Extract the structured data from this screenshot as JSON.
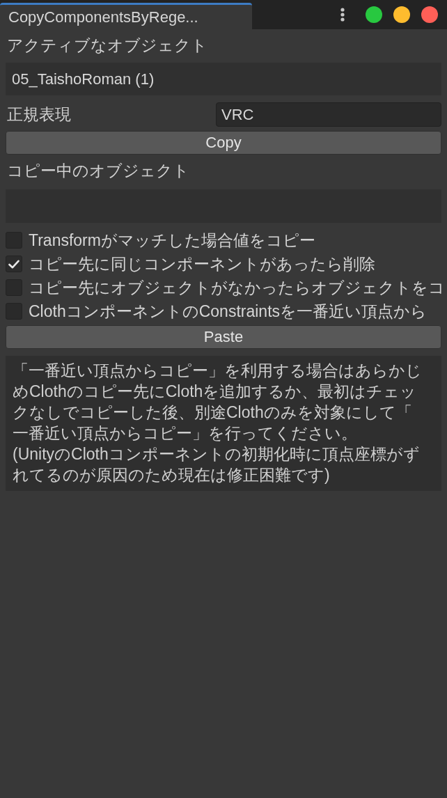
{
  "window": {
    "tab_title": "CopyComponentsByRege..."
  },
  "active_object": {
    "label": "アクティブなオブジェクト",
    "value": "05_TaishoRoman (1)"
  },
  "regex": {
    "label": "正規表現",
    "value": "VRC"
  },
  "copy_button": "Copy",
  "copying_object": {
    "label": "コピー中のオブジェクト"
  },
  "options": [
    {
      "label": "Transformがマッチした場合値をコピー",
      "checked": false
    },
    {
      "label": "コピー先に同じコンポーネントがあったら削除",
      "checked": true
    },
    {
      "label": "コピー先にオブジェクトがなかったらオブジェクトをコ",
      "checked": false
    },
    {
      "label": "ClothコンポーネントのConstraintsを一番近い頂点から",
      "checked": false
    }
  ],
  "paste_button": "Paste",
  "help_paragraphs": [
    "「一番近い頂点からコピー」を利用する場合はあらかじめClothのコピー先にClothを追加するか、最初はチェックなしでコピーした後、別途Clothのみを対象にして「一番近い頂点からコピー」を行ってください。",
    "(UnityのClothコンポーネントの初期化時に頂点座標がずれてるのが原因のため現在は修正困難です)"
  ]
}
